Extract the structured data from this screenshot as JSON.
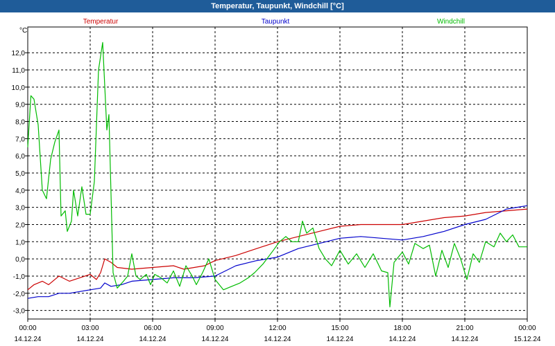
{
  "window": {
    "title": "Temperatur, Taupunkt, Windchill [°C]"
  },
  "chart_data": {
    "type": "line",
    "title": "Temperatur, Taupunkt, Windchill [°C]",
    "ylabel": "°C",
    "xlabel": "",
    "ylim": [
      -3.5,
      13.5
    ],
    "xlim": [
      0,
      24
    ],
    "yticks": [
      -3,
      -2,
      -1,
      0,
      1,
      2,
      3,
      4,
      5,
      6,
      7,
      8,
      9,
      10,
      11,
      12
    ],
    "ytick_labels": [
      "-3,0",
      "-2,0",
      "-1,0",
      "0,0",
      "1,0",
      "2,0",
      "3,0",
      "4,0",
      "5,0",
      "6,0",
      "7,0",
      "8,0",
      "9,0",
      "10,0",
      "11,0",
      "12,0"
    ],
    "xticks": [
      {
        "time": "00:00",
        "date": "14.12.24"
      },
      {
        "time": "03:00",
        "date": "14.12.24"
      },
      {
        "time": "06:00",
        "date": "14.12.24"
      },
      {
        "time": "09:00",
        "date": "14.12.24"
      },
      {
        "time": "12:00",
        "date": "14.12.24"
      },
      {
        "time": "15:00",
        "date": "14.12.24"
      },
      {
        "time": "18:00",
        "date": "14.12.24"
      },
      {
        "time": "21:00",
        "date": "14.12.24"
      },
      {
        "time": "00:00",
        "date": "15.12.24"
      }
    ],
    "grid": true,
    "legend_placement": "top",
    "series": [
      {
        "name": "Temperatur",
        "color": "#cc0000",
        "points": [
          [
            0,
            -1.8
          ],
          [
            0.3,
            -1.5
          ],
          [
            0.7,
            -1.3
          ],
          [
            1.0,
            -1.5
          ],
          [
            1.5,
            -1.0
          ],
          [
            2.0,
            -1.3
          ],
          [
            2.5,
            -1.1
          ],
          [
            3.0,
            -0.9
          ],
          [
            3.3,
            -1.2
          ],
          [
            3.5,
            -0.8
          ],
          [
            3.7,
            0.0
          ],
          [
            4.0,
            -0.2
          ],
          [
            4.3,
            -0.5
          ],
          [
            5.0,
            -0.6
          ],
          [
            6.0,
            -0.5
          ],
          [
            7.0,
            -0.4
          ],
          [
            7.5,
            -0.6
          ],
          [
            8.0,
            -0.5
          ],
          [
            8.5,
            -0.4
          ],
          [
            9.0,
            -0.1
          ],
          [
            10.0,
            0.2
          ],
          [
            11.0,
            0.6
          ],
          [
            11.5,
            0.8
          ],
          [
            12.0,
            1.0
          ],
          [
            13.0,
            1.3
          ],
          [
            14.0,
            1.6
          ],
          [
            15.0,
            1.9
          ],
          [
            16.0,
            2.0
          ],
          [
            17.0,
            2.0
          ],
          [
            18.0,
            2.0
          ],
          [
            19.0,
            2.2
          ],
          [
            20.0,
            2.4
          ],
          [
            21.0,
            2.5
          ],
          [
            22.0,
            2.7
          ],
          [
            23.0,
            2.8
          ],
          [
            24.0,
            2.9
          ]
        ]
      },
      {
        "name": "Taupunkt",
        "color": "#0000cc",
        "points": [
          [
            0,
            -2.3
          ],
          [
            0.5,
            -2.2
          ],
          [
            1.0,
            -2.2
          ],
          [
            1.5,
            -2.0
          ],
          [
            2.0,
            -2.0
          ],
          [
            2.5,
            -1.9
          ],
          [
            3.0,
            -1.8
          ],
          [
            3.5,
            -1.7
          ],
          [
            3.7,
            -1.4
          ],
          [
            4.0,
            -1.6
          ],
          [
            4.5,
            -1.5
          ],
          [
            5.0,
            -1.3
          ],
          [
            6.0,
            -1.2
          ],
          [
            7.0,
            -1.1
          ],
          [
            8.0,
            -1.1
          ],
          [
            9.0,
            -1.0
          ],
          [
            10.0,
            -0.4
          ],
          [
            11.0,
            -0.1
          ],
          [
            12.0,
            0.1
          ],
          [
            13.0,
            0.6
          ],
          [
            14.0,
            0.9
          ],
          [
            15.0,
            1.2
          ],
          [
            16.0,
            1.3
          ],
          [
            17.0,
            1.2
          ],
          [
            18.0,
            1.1
          ],
          [
            19.0,
            1.3
          ],
          [
            20.0,
            1.6
          ],
          [
            21.0,
            2.0
          ],
          [
            22.0,
            2.3
          ],
          [
            23.0,
            2.9
          ],
          [
            24.0,
            3.1
          ]
        ]
      },
      {
        "name": "Windchill",
        "color": "#00bb00",
        "points": [
          [
            0,
            6.5
          ],
          [
            0.15,
            9.5
          ],
          [
            0.3,
            9.3
          ],
          [
            0.5,
            7.8
          ],
          [
            0.7,
            4.0
          ],
          [
            0.9,
            3.5
          ],
          [
            1.1,
            5.8
          ],
          [
            1.3,
            6.8
          ],
          [
            1.5,
            7.5
          ],
          [
            1.6,
            2.5
          ],
          [
            1.8,
            2.8
          ],
          [
            1.9,
            1.6
          ],
          [
            2.1,
            2.2
          ],
          [
            2.2,
            4.0
          ],
          [
            2.4,
            2.5
          ],
          [
            2.6,
            4.2
          ],
          [
            2.8,
            2.6
          ],
          [
            3.0,
            2.6
          ],
          [
            3.2,
            4.5
          ],
          [
            3.4,
            11.0
          ],
          [
            3.6,
            12.6
          ],
          [
            3.8,
            7.5
          ],
          [
            3.9,
            8.4
          ],
          [
            4.1,
            -0.8
          ],
          [
            4.3,
            -1.7
          ],
          [
            4.6,
            -1.3
          ],
          [
            4.8,
            -1.0
          ],
          [
            5.0,
            0.3
          ],
          [
            5.2,
            -1.0
          ],
          [
            5.4,
            -1.2
          ],
          [
            5.7,
            -0.9
          ],
          [
            5.9,
            -1.5
          ],
          [
            6.1,
            -0.9
          ],
          [
            6.4,
            -1.1
          ],
          [
            6.7,
            -1.4
          ],
          [
            7.0,
            -0.7
          ],
          [
            7.3,
            -1.6
          ],
          [
            7.6,
            -0.4
          ],
          [
            7.9,
            -1.0
          ],
          [
            8.1,
            -1.5
          ],
          [
            8.4,
            -0.8
          ],
          [
            8.7,
            0.0
          ],
          [
            9.0,
            -1.2
          ],
          [
            9.4,
            -1.8
          ],
          [
            9.8,
            -1.6
          ],
          [
            10.2,
            -1.4
          ],
          [
            10.6,
            -1.1
          ],
          [
            10.9,
            -0.8
          ],
          [
            11.3,
            -0.3
          ],
          [
            11.8,
            0.5
          ],
          [
            12.1,
            1.0
          ],
          [
            12.4,
            1.3
          ],
          [
            12.7,
            1.0
          ],
          [
            13.0,
            1.0
          ],
          [
            13.2,
            2.2
          ],
          [
            13.4,
            1.5
          ],
          [
            13.7,
            1.8
          ],
          [
            14.0,
            0.6
          ],
          [
            14.3,
            0.0
          ],
          [
            14.6,
            -0.4
          ],
          [
            15.0,
            0.5
          ],
          [
            15.4,
            -0.3
          ],
          [
            15.8,
            0.3
          ],
          [
            16.2,
            -0.5
          ],
          [
            16.6,
            0.3
          ],
          [
            17.0,
            -0.7
          ],
          [
            17.3,
            -0.8
          ],
          [
            17.4,
            -2.8
          ],
          [
            17.6,
            -0.2
          ],
          [
            18.0,
            0.4
          ],
          [
            18.3,
            -0.3
          ],
          [
            18.6,
            0.9
          ],
          [
            19.0,
            0.6
          ],
          [
            19.3,
            0.8
          ],
          [
            19.6,
            -1.0
          ],
          [
            19.9,
            0.5
          ],
          [
            20.2,
            -0.5
          ],
          [
            20.5,
            0.9
          ],
          [
            20.8,
            0.0
          ],
          [
            21.1,
            -1.2
          ],
          [
            21.4,
            0.3
          ],
          [
            21.7,
            -0.2
          ],
          [
            22.0,
            1.0
          ],
          [
            22.4,
            0.7
          ],
          [
            22.7,
            1.5
          ],
          [
            23.0,
            1.0
          ],
          [
            23.3,
            1.4
          ],
          [
            23.6,
            0.7
          ],
          [
            24.0,
            0.7
          ]
        ]
      }
    ]
  }
}
